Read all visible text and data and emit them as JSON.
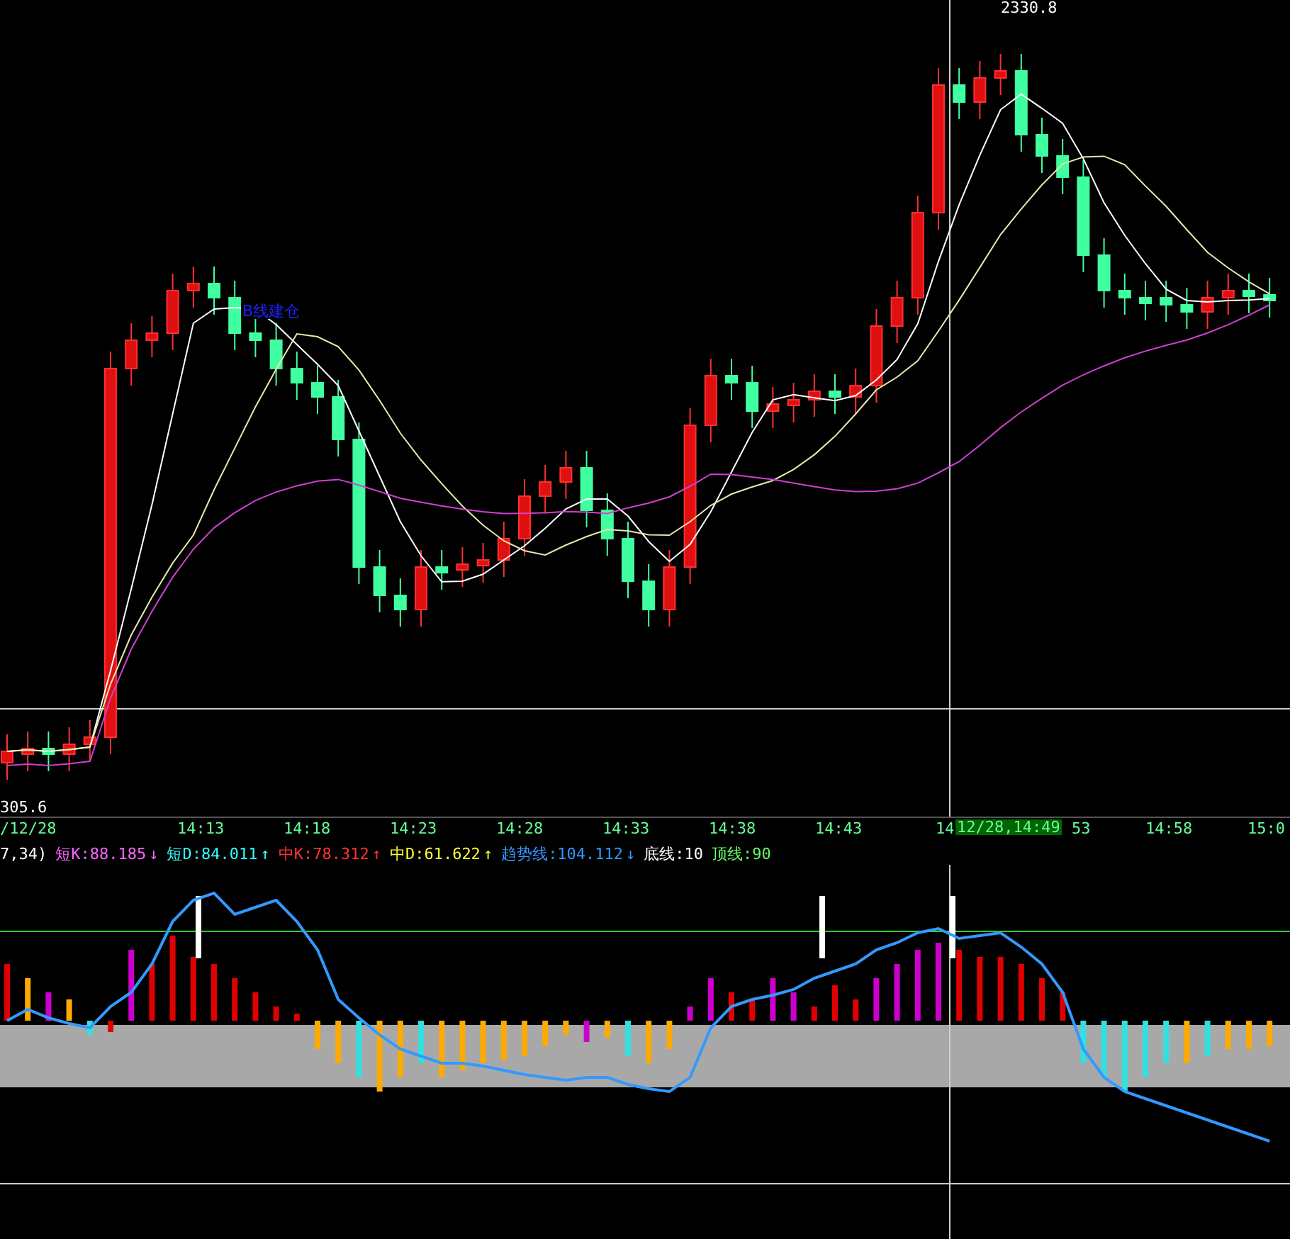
{
  "price_chart": {
    "high_label": "2330.8",
    "low_label": "305.6",
    "annotation": "B线建仓"
  },
  "time_axis": {
    "labels": [
      "/12/28",
      "14:13",
      "14:18",
      "14:23",
      "14:28",
      "14:33",
      "14:38",
      "14:43",
      "14",
      "53",
      "14:58",
      "15:0"
    ],
    "cursor_label": "12/28,14:49"
  },
  "indicator_legend": [
    {
      "text": "7,34)",
      "color": "#ffffff"
    },
    {
      "text": "短K:88.185",
      "arrow": "↓",
      "color": "#ff66ff"
    },
    {
      "text": "短D:84.011",
      "arrow": "↑",
      "color": "#33ffff"
    },
    {
      "text": "中K:78.312",
      "arrow": "↑",
      "color": "#ff3333"
    },
    {
      "text": "中D:61.622",
      "arrow": "↑",
      "color": "#ffff33"
    },
    {
      "text": "趋势线:104.112",
      "arrow": "↓",
      "color": "#3399ff"
    },
    {
      "text": "底线:10",
      "color": "#ffffff"
    },
    {
      "text": "顶线:90",
      "color": "#66ff66"
    }
  ]
}
